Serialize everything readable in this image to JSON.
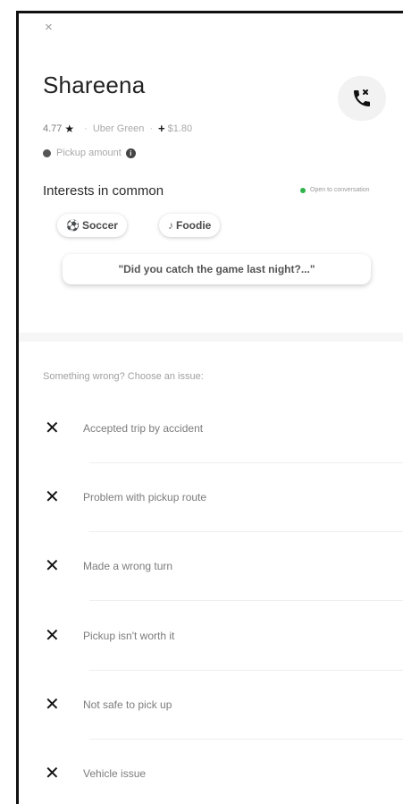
{
  "header": {
    "close_icon": "×"
  },
  "rider": {
    "name": "Shareena",
    "rating": "4.77",
    "star": "★",
    "tier": "Uber Green",
    "bonus_sign": "+",
    "bonus": "$1.80",
    "pickup_label": "Pickup amount"
  },
  "interests": {
    "title": "Interests in common",
    "status": "Open to conversation",
    "status_color": "#2fb24a",
    "chips": [
      {
        "icon": "⚽",
        "label": "Soccer"
      },
      {
        "icon": "♪",
        "label": "Foodie"
      }
    ],
    "suggestion": "\"Did you catch the game last night?...\""
  },
  "issues": {
    "heading": "Something wrong? Choose an issue:",
    "items": [
      {
        "label": "Accepted trip by accident"
      },
      {
        "label": "Problem with pickup route"
      },
      {
        "label": "Made a wrong turn"
      },
      {
        "label": "Pickup isn't worth it"
      },
      {
        "label": "Not safe to pick up"
      },
      {
        "label": "Vehicle issue"
      }
    ]
  }
}
